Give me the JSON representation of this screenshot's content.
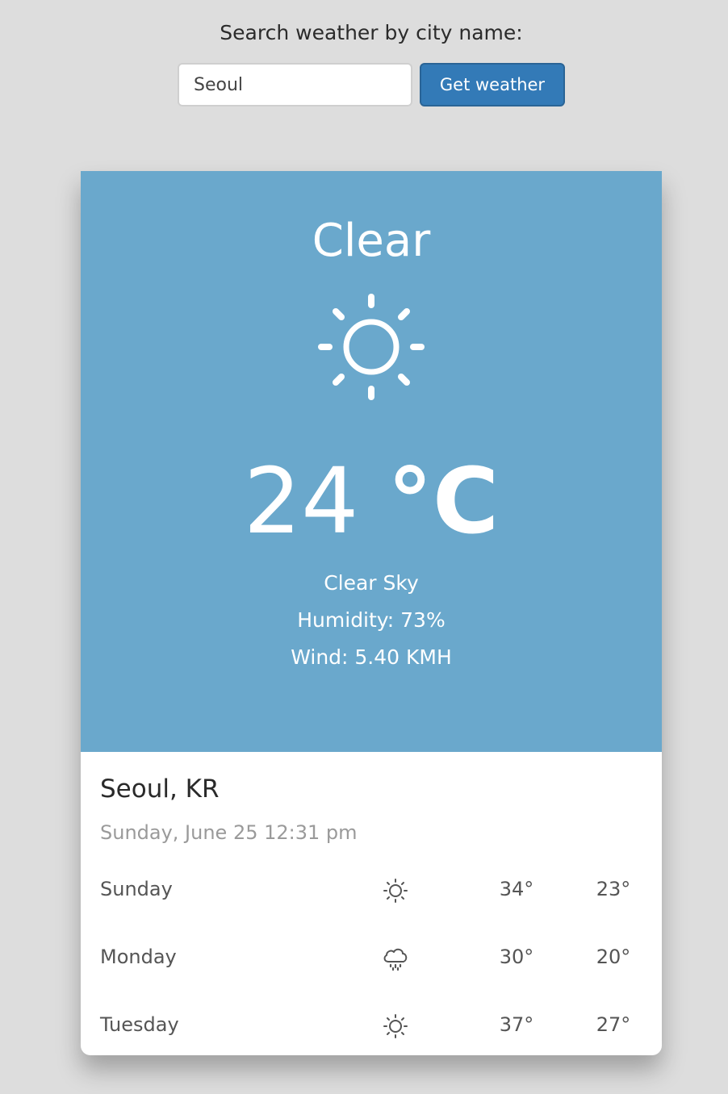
{
  "search": {
    "label": "Search weather by city name:",
    "value": "Seoul",
    "button_label": "Get weather"
  },
  "current": {
    "condition": "Clear",
    "icon": "sun-icon",
    "temp_value": "24",
    "temp_unit": "°C",
    "description": "Clear Sky",
    "humidity": "Humidity: 73%",
    "wind": "Wind: 5.40 KMH"
  },
  "location": {
    "name": "Seoul, KR",
    "datetime": "Sunday, June 25 12:31 pm"
  },
  "forecast": [
    {
      "day": "Sunday",
      "icon": "sun-icon",
      "high": "34°",
      "low": "23°"
    },
    {
      "day": "Monday",
      "icon": "rain-cloud-icon",
      "high": "30°",
      "low": "20°"
    },
    {
      "day": "Tuesday",
      "icon": "sun-icon",
      "high": "37°",
      "low": "27°"
    }
  ],
  "colors": {
    "hero_background": "#6aa8cc",
    "button_background": "#337ab7",
    "page_background": "#dddddd"
  }
}
